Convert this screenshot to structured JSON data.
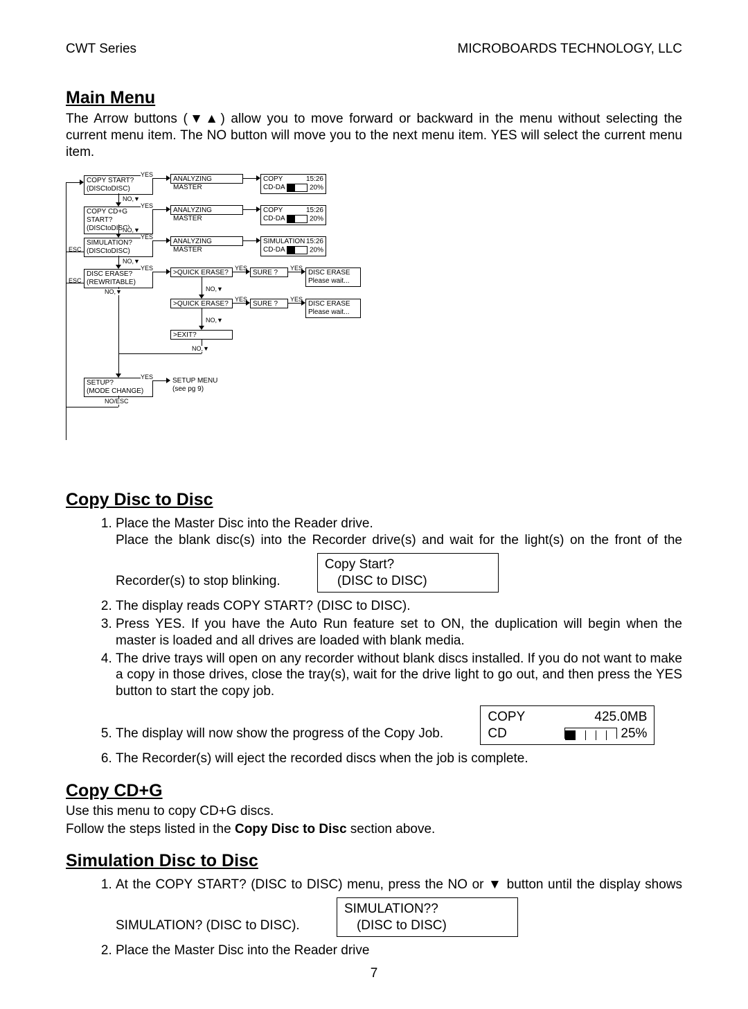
{
  "header": {
    "left": "CWT Series",
    "right": "MICROBOARDS TECHNOLOGY, LLC"
  },
  "sections": {
    "main_menu": {
      "title": "Main Menu",
      "intro": "The Arrow buttons (▼▲) allow you to move forward or backward in the menu without selecting the current menu item.  The NO button will move you to the next menu item.  YES will select the current menu item."
    },
    "copy_disc": {
      "title": "Copy Disc to Disc",
      "step1a": "Place the Master Disc into the Reader drive.",
      "step1b": "Place the blank disc(s) into the Recorder drive(s) and wait for the light(s) on the front of the Recorder(s) to stop blinking.",
      "box1_l1": "Copy Start?",
      "box1_l2": "(DISC to DISC)",
      "step2": "The display reads COPY START? (DISC to DISC).",
      "step3": "Press YES.  If you have the Auto Run feature set to ON, the duplication will begin when the master is loaded and all drives are loaded with blank media.",
      "step4": "The drive trays will open on any recorder without blank discs installed.  If you do not want to make a copy in those drives, close the tray(s), wait for the drive light to go out, and then press the YES button to start the copy job.",
      "step5": "The display will now show the progress of the Copy Job.",
      "box2_l1_left": "COPY",
      "box2_l1_right": "425.0MB",
      "box2_l2_left": "CD",
      "box2_l2_right": "25%",
      "step6": "The Recorder(s) will eject the recorded discs when the job is complete."
    },
    "copy_cdg": {
      "title": "Copy CD+G",
      "p1": "Use this menu to copy CD+G discs.",
      "p2a": "Follow the steps listed in the ",
      "p2b": "Copy Disc to Disc",
      "p2c": " section above."
    },
    "simulation": {
      "title": "Simulation Disc to Disc",
      "step1": "At the COPY START? (DISC to DISC) menu, press the NO or ▼ button until the display shows SIMULATION? (DISC to DISC).",
      "box1_l1": "SIMULATION??",
      "box1_l2": "(DISC to DISC)",
      "step2": "Place the Master Disc into the Reader drive"
    }
  },
  "page_number": "7",
  "flowchart": {
    "rows": [
      {
        "q": {
          "l1": "COPY START?",
          "l2": "(DISCtoDISC)"
        },
        "analyze": "ANALYZING MASTER",
        "result": {
          "l1l": "COPY",
          "l1r": "15:26",
          "l2l": "CD-DA",
          "l2r": "20%"
        },
        "yes": "YES",
        "no": "NO,▼"
      },
      {
        "q": {
          "l1": "COPY CD+G START?",
          "l2": "(DISCtoDISC)"
        },
        "analyze": "ANALYZING MASTER",
        "result": {
          "l1l": "COPY",
          "l1r": "15:26",
          "l2l": "CD-DA",
          "l2r": "20%"
        },
        "yes": "YES",
        "no": "NO,▼"
      },
      {
        "q": {
          "l1": "SIMULATION?",
          "l2": "(DISCtoDISC)"
        },
        "analyze": "ANALYZING MASTER",
        "result": {
          "l1l": "SIMULATION",
          "l1r": "15:26",
          "l2l": "CD-DA",
          "l2r": "20%"
        },
        "yes": "YES",
        "no": "NO,▼",
        "esc": "ESC"
      },
      {
        "q": {
          "l1": "DISC ERASE?",
          "l2": "(REWRITABLE)"
        },
        "yes": "YES",
        "no": "NO,▼",
        "esc": "ESC",
        "quick": ">QUICK ERASE?",
        "sure": "SURE ?",
        "result": {
          "l1": "DISC ERASE",
          "l2": "Please wait..."
        }
      },
      {
        "quick": ">QUICK ERASE?",
        "sure": "SURE ?",
        "yes": "YES",
        "no": "NO,▼",
        "result": {
          "l1": "DISC ERASE",
          "l2": "Please wait..."
        }
      },
      {
        "exit": ">EXIT?",
        "no": "NO,▼"
      },
      {
        "q": {
          "l1": "SETUP?",
          "l2": "(MODE CHANGE)"
        },
        "yes": "YES",
        "menu": {
          "l1": "SETUP MENU",
          "l2": "(see pg 9)"
        },
        "noesc": "NO/ESC"
      }
    ]
  }
}
